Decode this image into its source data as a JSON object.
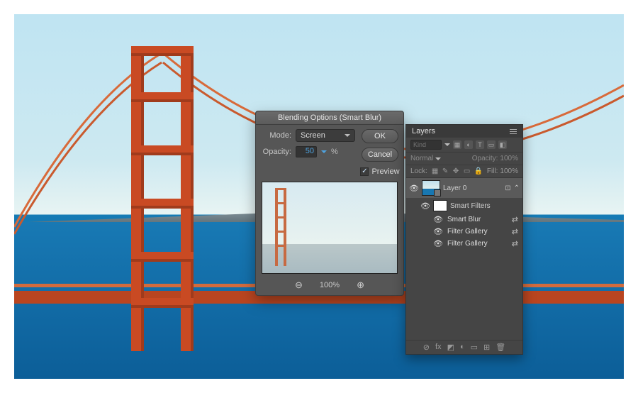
{
  "dialog": {
    "title": "Blending Options (Smart Blur)",
    "mode_label": "Mode:",
    "mode_value": "Screen",
    "opacity_label": "Opacity:",
    "opacity_value": "50",
    "opacity_unit": "%",
    "ok": "OK",
    "cancel": "Cancel",
    "preview_label": "Preview",
    "zoom_out": "⊖",
    "zoom_level": "100%",
    "zoom_in": "⊕"
  },
  "layers": {
    "title": "Layers",
    "kind_placeholder": "Kind",
    "blend_mode": "Normal",
    "opacity_label": "Opacity:",
    "opacity_value": "100%",
    "lock_label": "Lock:",
    "fill_label": "Fill:",
    "fill_value": "100%",
    "items": [
      {
        "name": "Layer 0"
      }
    ],
    "smart_filters_label": "Smart Filters",
    "filters": [
      "Smart Blur",
      "Filter Gallery",
      "Filter Gallery"
    ]
  }
}
